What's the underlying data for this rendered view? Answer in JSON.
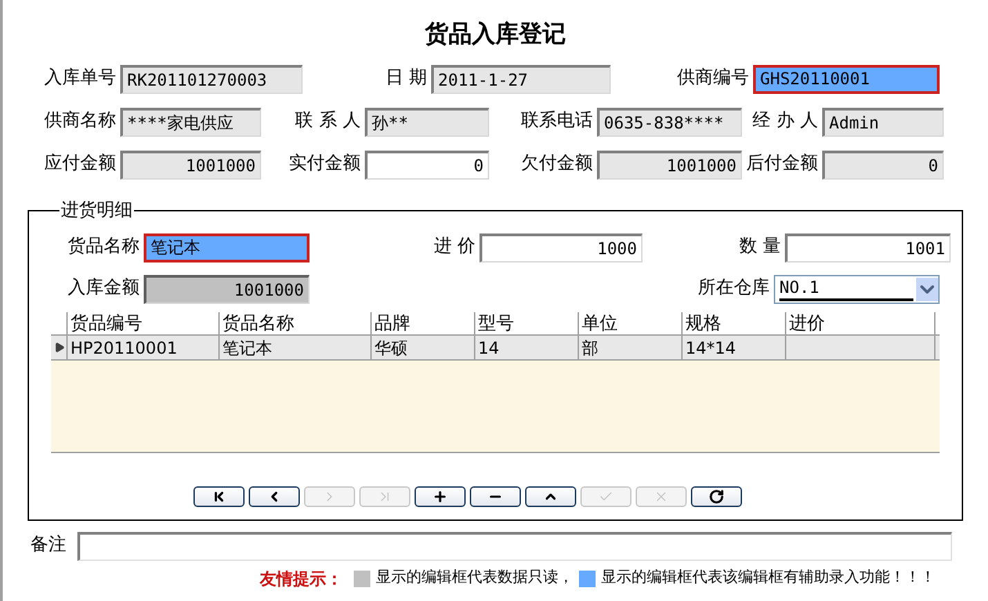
{
  "window": {
    "title": "货品入库登记"
  },
  "header_rows": [
    [
      {
        "label": "入库单号",
        "value": "RK201101270003",
        "kind": "readonly"
      },
      {
        "label": "日 期",
        "value": "2011-1-27",
        "kind": "readonly"
      },
      {
        "label": "供商编号",
        "value": "GHS20110001",
        "kind": "lookup"
      }
    ],
    [
      {
        "label": "供商名称",
        "value": "****家电供应",
        "kind": "readonly"
      },
      {
        "label": "联 系 人",
        "value": "孙**",
        "kind": "readonly"
      },
      {
        "label": "联系电话",
        "value": "0635-838****",
        "kind": "readonly"
      },
      {
        "label": "经 办 人",
        "value": "Admin",
        "kind": "readonly"
      }
    ],
    [
      {
        "label": "应付金额",
        "value": "1001000",
        "kind": "readonly"
      },
      {
        "label": "实付金额",
        "value": "0",
        "kind": "editable"
      },
      {
        "label": "欠付金额",
        "value": "1001000",
        "kind": "readonly"
      },
      {
        "label": "后付金额",
        "value": "0",
        "kind": "readonly"
      }
    ]
  ],
  "detail": {
    "title": "进货明细",
    "fields": [
      {
        "label": "货品名称",
        "value": "笔记本",
        "kind": "lookup"
      },
      {
        "label": "进 价",
        "value": "1000",
        "kind": "editable"
      },
      {
        "label": "数 量",
        "value": "1001",
        "kind": "editable"
      }
    ],
    "amount": {
      "label": "入库金额",
      "value": "1001000",
      "kind": "dark"
    },
    "warehouse": {
      "label": "所在仓库",
      "value": "NO.1"
    },
    "table": {
      "columns": [
        "货品编号",
        "货品名称",
        "品牌",
        "型号",
        "单位",
        "规格",
        "进价"
      ],
      "rows": [
        {
          "cells": [
            "HP20110001",
            "笔记本",
            "华硕",
            "14",
            "部",
            "14*14",
            ""
          ],
          "selected": true
        }
      ]
    },
    "nav_buttons": [
      {
        "kind": "first",
        "disabled": false
      },
      {
        "kind": "prev",
        "disabled": false
      },
      {
        "kind": "next",
        "disabled": true
      },
      {
        "kind": "last",
        "disabled": true
      },
      {
        "kind": "add",
        "disabled": false
      },
      {
        "kind": "delete",
        "disabled": false
      },
      {
        "kind": "edit",
        "disabled": false
      },
      {
        "kind": "post",
        "disabled": true
      },
      {
        "kind": "cancel",
        "disabled": true
      },
      {
        "kind": "refresh",
        "disabled": false
      }
    ]
  },
  "remark": {
    "label": "备注"
  },
  "hint": {
    "label": "友情提示：",
    "items": [
      {
        "color": "#c0c0c0",
        "text": "显示的编辑框代表数据只读，"
      },
      {
        "color": "#66aaff",
        "text": "显示的编辑框代表该编辑框有辅助录入功能！！！"
      }
    ]
  }
}
